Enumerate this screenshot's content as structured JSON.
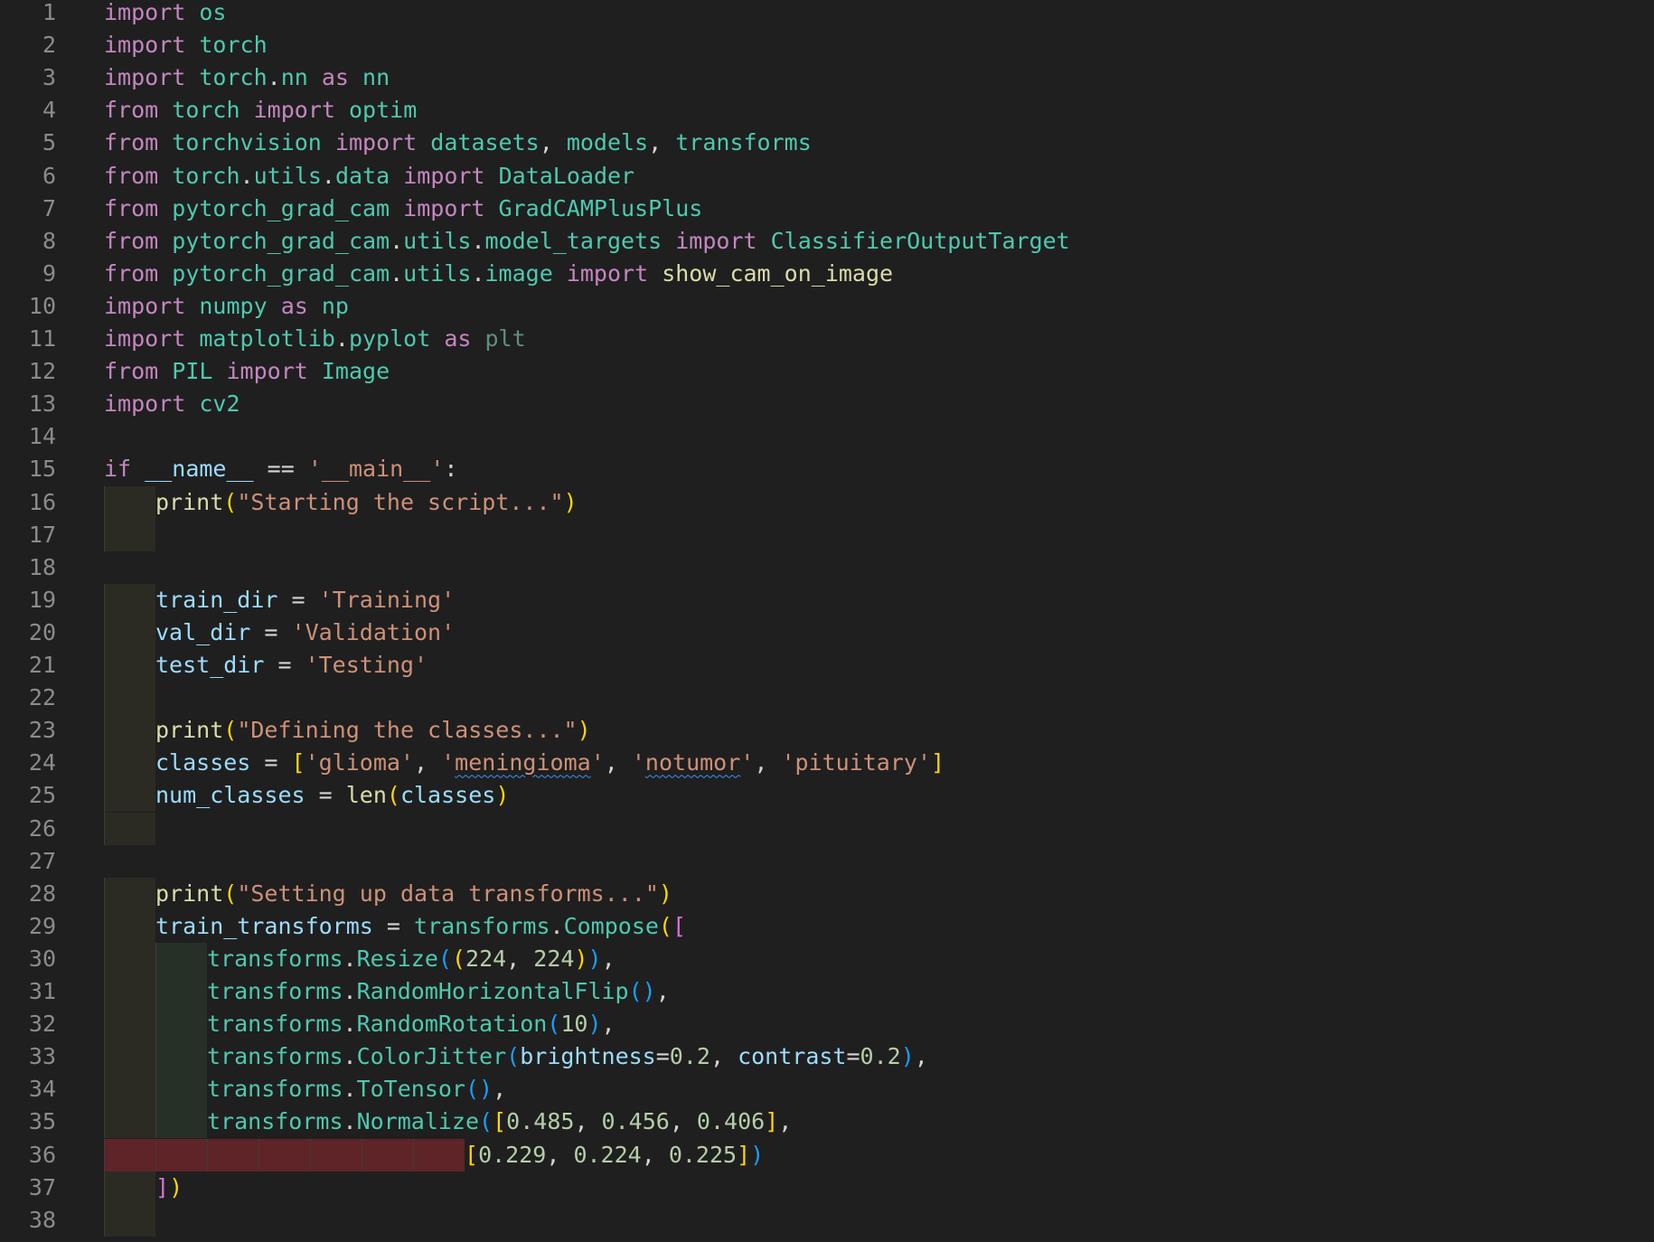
{
  "editor": {
    "lines": [
      {
        "n": "1",
        "tokens": [
          [
            "kw",
            "import"
          ],
          [
            "op",
            " "
          ],
          [
            "mod",
            "os"
          ]
        ]
      },
      {
        "n": "2",
        "tokens": [
          [
            "kw",
            "import"
          ],
          [
            "op",
            " "
          ],
          [
            "mod",
            "torch"
          ]
        ]
      },
      {
        "n": "3",
        "tokens": [
          [
            "kw",
            "import"
          ],
          [
            "op",
            " "
          ],
          [
            "mod",
            "torch"
          ],
          [
            "op",
            "."
          ],
          [
            "mod",
            "nn"
          ],
          [
            "op",
            " "
          ],
          [
            "kw",
            "as"
          ],
          [
            "op",
            " "
          ],
          [
            "mod",
            "nn"
          ]
        ]
      },
      {
        "n": "4",
        "tokens": [
          [
            "kw",
            "from"
          ],
          [
            "op",
            " "
          ],
          [
            "mod",
            "torch"
          ],
          [
            "op",
            " "
          ],
          [
            "kw",
            "import"
          ],
          [
            "op",
            " "
          ],
          [
            "mod",
            "optim"
          ]
        ]
      },
      {
        "n": "5",
        "tokens": [
          [
            "kw",
            "from"
          ],
          [
            "op",
            " "
          ],
          [
            "mod",
            "torchvision"
          ],
          [
            "op",
            " "
          ],
          [
            "kw",
            "import"
          ],
          [
            "op",
            " "
          ],
          [
            "mod",
            "datasets"
          ],
          [
            "op",
            ", "
          ],
          [
            "mod",
            "models"
          ],
          [
            "op",
            ", "
          ],
          [
            "mod",
            "transforms"
          ]
        ]
      },
      {
        "n": "6",
        "tokens": [
          [
            "kw",
            "from"
          ],
          [
            "op",
            " "
          ],
          [
            "mod",
            "torch"
          ],
          [
            "op",
            "."
          ],
          [
            "mod",
            "utils"
          ],
          [
            "op",
            "."
          ],
          [
            "mod",
            "data"
          ],
          [
            "op",
            " "
          ],
          [
            "kw",
            "import"
          ],
          [
            "op",
            " "
          ],
          [
            "ns",
            "DataLoader"
          ]
        ]
      },
      {
        "n": "7",
        "tokens": [
          [
            "kw",
            "from"
          ],
          [
            "op",
            " "
          ],
          [
            "mod",
            "pytorch_grad_cam"
          ],
          [
            "op",
            " "
          ],
          [
            "kw",
            "import"
          ],
          [
            "op",
            " "
          ],
          [
            "ns",
            "GradCAMPlusPlus"
          ]
        ]
      },
      {
        "n": "8",
        "tokens": [
          [
            "kw",
            "from"
          ],
          [
            "op",
            " "
          ],
          [
            "mod",
            "pytorch_grad_cam"
          ],
          [
            "op",
            "."
          ],
          [
            "mod",
            "utils"
          ],
          [
            "op",
            "."
          ],
          [
            "mod",
            "model_targets"
          ],
          [
            "op",
            " "
          ],
          [
            "kw",
            "import"
          ],
          [
            "op",
            " "
          ],
          [
            "ns",
            "ClassifierOutputTarget"
          ]
        ]
      },
      {
        "n": "9",
        "tokens": [
          [
            "kw",
            "from"
          ],
          [
            "op",
            " "
          ],
          [
            "mod",
            "pytorch_grad_cam"
          ],
          [
            "op",
            "."
          ],
          [
            "mod",
            "utils"
          ],
          [
            "op",
            "."
          ],
          [
            "mod",
            "image"
          ],
          [
            "op",
            " "
          ],
          [
            "kw",
            "import"
          ],
          [
            "op",
            " "
          ],
          [
            "fn",
            "show_cam_on_image"
          ]
        ]
      },
      {
        "n": "10",
        "tokens": [
          [
            "kw",
            "import"
          ],
          [
            "op",
            " "
          ],
          [
            "mod",
            "numpy"
          ],
          [
            "op",
            " "
          ],
          [
            "kw",
            "as"
          ],
          [
            "op",
            " "
          ],
          [
            "mod",
            "np"
          ]
        ]
      },
      {
        "n": "11",
        "tokens": [
          [
            "kw",
            "import"
          ],
          [
            "op",
            " "
          ],
          [
            "mod",
            "matplotlib"
          ],
          [
            "op",
            "."
          ],
          [
            "mod",
            "pyplot"
          ],
          [
            "op",
            " "
          ],
          [
            "kw",
            "as"
          ],
          [
            "op",
            " "
          ],
          [
            "plt",
            "plt"
          ]
        ]
      },
      {
        "n": "12",
        "tokens": [
          [
            "kw",
            "from"
          ],
          [
            "op",
            " "
          ],
          [
            "mod",
            "PIL"
          ],
          [
            "op",
            " "
          ],
          [
            "kw",
            "import"
          ],
          [
            "op",
            " "
          ],
          [
            "ns",
            "Image"
          ]
        ]
      },
      {
        "n": "13",
        "tokens": [
          [
            "kw",
            "import"
          ],
          [
            "op",
            " "
          ],
          [
            "mod",
            "cv2"
          ]
        ]
      },
      {
        "n": "14",
        "tokens": []
      },
      {
        "n": "15",
        "tokens": [
          [
            "kw",
            "if"
          ],
          [
            "op",
            " "
          ],
          [
            "var",
            "__name__"
          ],
          [
            "op",
            " == "
          ],
          [
            "str",
            "'__main__'"
          ],
          [
            "op",
            ":"
          ]
        ]
      },
      {
        "n": "16",
        "indent": 1,
        "tokens": [
          [
            "fn",
            "print"
          ],
          [
            "b1",
            "("
          ],
          [
            "str",
            "\"Starting the script...\""
          ],
          [
            "b1",
            ")"
          ]
        ]
      },
      {
        "n": "17",
        "indent": 1,
        "tokens": []
      },
      {
        "n": "18",
        "tokens": []
      },
      {
        "n": "19",
        "indent": 1,
        "tokens": [
          [
            "var",
            "train_dir"
          ],
          [
            "op",
            " = "
          ],
          [
            "str",
            "'Training'"
          ]
        ]
      },
      {
        "n": "20",
        "indent": 1,
        "tokens": [
          [
            "var",
            "val_dir"
          ],
          [
            "op",
            " = "
          ],
          [
            "str",
            "'Validation'"
          ]
        ]
      },
      {
        "n": "21",
        "indent": 1,
        "tokens": [
          [
            "var",
            "test_dir"
          ],
          [
            "op",
            " = "
          ],
          [
            "str",
            "'Testing'"
          ]
        ]
      },
      {
        "n": "22",
        "indent": 1,
        "tokens": []
      },
      {
        "n": "23",
        "indent": 1,
        "tokens": [
          [
            "fn",
            "print"
          ],
          [
            "b1",
            "("
          ],
          [
            "str",
            "\"Defining the classes...\""
          ],
          [
            "b1",
            ")"
          ]
        ]
      },
      {
        "n": "24",
        "indent": 1,
        "tokens": [
          [
            "var",
            "classes"
          ],
          [
            "op",
            " = "
          ],
          [
            "b1",
            "["
          ],
          [
            "str",
            "'glioma'"
          ],
          [
            "op",
            ", "
          ],
          [
            "str",
            "'"
          ],
          [
            "strsq",
            "meningioma"
          ],
          [
            "str",
            "'"
          ],
          [
            "op",
            ", "
          ],
          [
            "str",
            "'"
          ],
          [
            "strsq",
            "notumor"
          ],
          [
            "str",
            "'"
          ],
          [
            "op",
            ", "
          ],
          [
            "str",
            "'pituitary'"
          ],
          [
            "b1",
            "]"
          ]
        ]
      },
      {
        "n": "25",
        "indent": 1,
        "tokens": [
          [
            "var",
            "num_classes"
          ],
          [
            "op",
            " = "
          ],
          [
            "fn",
            "len"
          ],
          [
            "b1",
            "("
          ],
          [
            "var",
            "classes"
          ],
          [
            "b1",
            ")"
          ]
        ]
      },
      {
        "n": "26",
        "indent": 1,
        "tokens": []
      },
      {
        "n": "27",
        "tokens": []
      },
      {
        "n": "28",
        "indent": 1,
        "tokens": [
          [
            "fn",
            "print"
          ],
          [
            "b1",
            "("
          ],
          [
            "str",
            "\"Setting up data transforms...\""
          ],
          [
            "b1",
            ")"
          ]
        ]
      },
      {
        "n": "29",
        "indent": 1,
        "tokens": [
          [
            "var",
            "train_transforms"
          ],
          [
            "op",
            " = "
          ],
          [
            "mod",
            "transforms"
          ],
          [
            "op",
            "."
          ],
          [
            "ns",
            "Compose"
          ],
          [
            "b1",
            "("
          ],
          [
            "b2",
            "["
          ]
        ]
      },
      {
        "n": "30",
        "indent": 2,
        "tokens": [
          [
            "mod",
            "transforms"
          ],
          [
            "op",
            "."
          ],
          [
            "ns",
            "Resize"
          ],
          [
            "b3",
            "("
          ],
          [
            "b1",
            "("
          ],
          [
            "num",
            "224"
          ],
          [
            "op",
            ", "
          ],
          [
            "num",
            "224"
          ],
          [
            "b1",
            ")"
          ],
          [
            "b3",
            ")"
          ],
          [
            "op",
            ","
          ]
        ]
      },
      {
        "n": "31",
        "indent": 2,
        "tokens": [
          [
            "mod",
            "transforms"
          ],
          [
            "op",
            "."
          ],
          [
            "ns",
            "RandomHorizontalFlip"
          ],
          [
            "b3",
            "()"
          ],
          [
            "op",
            ","
          ]
        ]
      },
      {
        "n": "32",
        "indent": 2,
        "tokens": [
          [
            "mod",
            "transforms"
          ],
          [
            "op",
            "."
          ],
          [
            "ns",
            "RandomRotation"
          ],
          [
            "b3",
            "("
          ],
          [
            "num",
            "10"
          ],
          [
            "b3",
            ")"
          ],
          [
            "op",
            ","
          ]
        ]
      },
      {
        "n": "33",
        "indent": 2,
        "tokens": [
          [
            "mod",
            "transforms"
          ],
          [
            "op",
            "."
          ],
          [
            "ns",
            "ColorJitter"
          ],
          [
            "b3",
            "("
          ],
          [
            "var",
            "brightness"
          ],
          [
            "op",
            "="
          ],
          [
            "num",
            "0.2"
          ],
          [
            "op",
            ", "
          ],
          [
            "var",
            "contrast"
          ],
          [
            "op",
            "="
          ],
          [
            "num",
            "0.2"
          ],
          [
            "b3",
            ")"
          ],
          [
            "op",
            ","
          ]
        ]
      },
      {
        "n": "34",
        "indent": 2,
        "tokens": [
          [
            "mod",
            "transforms"
          ],
          [
            "op",
            "."
          ],
          [
            "ns",
            "ToTensor"
          ],
          [
            "b3",
            "()"
          ],
          [
            "op",
            ","
          ]
        ]
      },
      {
        "n": "35",
        "indent": 2,
        "tokens": [
          [
            "mod",
            "transforms"
          ],
          [
            "op",
            "."
          ],
          [
            "ns",
            "Normalize"
          ],
          [
            "b3",
            "("
          ],
          [
            "b1",
            "["
          ],
          [
            "num",
            "0.485"
          ],
          [
            "op",
            ", "
          ],
          [
            "num",
            "0.456"
          ],
          [
            "op",
            ", "
          ],
          [
            "num",
            "0.406"
          ],
          [
            "b1",
            "]"
          ],
          [
            "op",
            ","
          ]
        ]
      },
      {
        "n": "36",
        "indent": 7,
        "error": true,
        "tokens": [
          [
            "b1",
            "["
          ],
          [
            "num",
            "0.229"
          ],
          [
            "op",
            ", "
          ],
          [
            "num",
            "0.224"
          ],
          [
            "op",
            ", "
          ],
          [
            "num",
            "0.225"
          ],
          [
            "b1",
            "]"
          ],
          [
            "b3",
            ")"
          ]
        ]
      },
      {
        "n": "37",
        "indent": 1,
        "tokens": [
          [
            "b2",
            "]"
          ],
          [
            "b1",
            ")"
          ]
        ]
      },
      {
        "n": "38",
        "indent": 1,
        "tokens": []
      }
    ]
  }
}
